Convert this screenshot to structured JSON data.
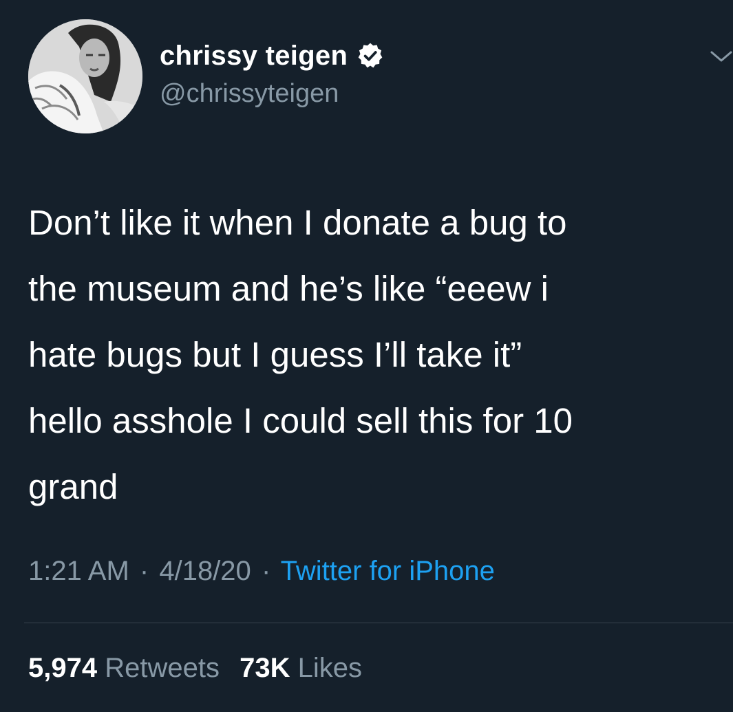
{
  "tweet": {
    "display_name": "chrissy teigen",
    "handle": "@chrissyteigen",
    "verified": true,
    "body_lines": [
      "Don’t like it when I donate a bug to",
      "the museum and he’s like “eeew i",
      "hate bugs but I guess I’ll take it”",
      "hello asshole I could sell this for 10",
      "grand"
    ],
    "time": "1:21 AM",
    "date": "4/18/20",
    "separator": "·",
    "source": "Twitter for iPhone",
    "retweets_count": "5,974",
    "retweets_label": "Retweets",
    "likes_count": "73K",
    "likes_label": "Likes"
  },
  "icons": {
    "verified": "verified-badge-icon",
    "caret": "chevron-down-icon"
  },
  "colors": {
    "background": "#15202b",
    "primary_text": "#ffffff",
    "secondary_text": "#8899a6",
    "link": "#1da1f2",
    "divider": "#38444d"
  }
}
